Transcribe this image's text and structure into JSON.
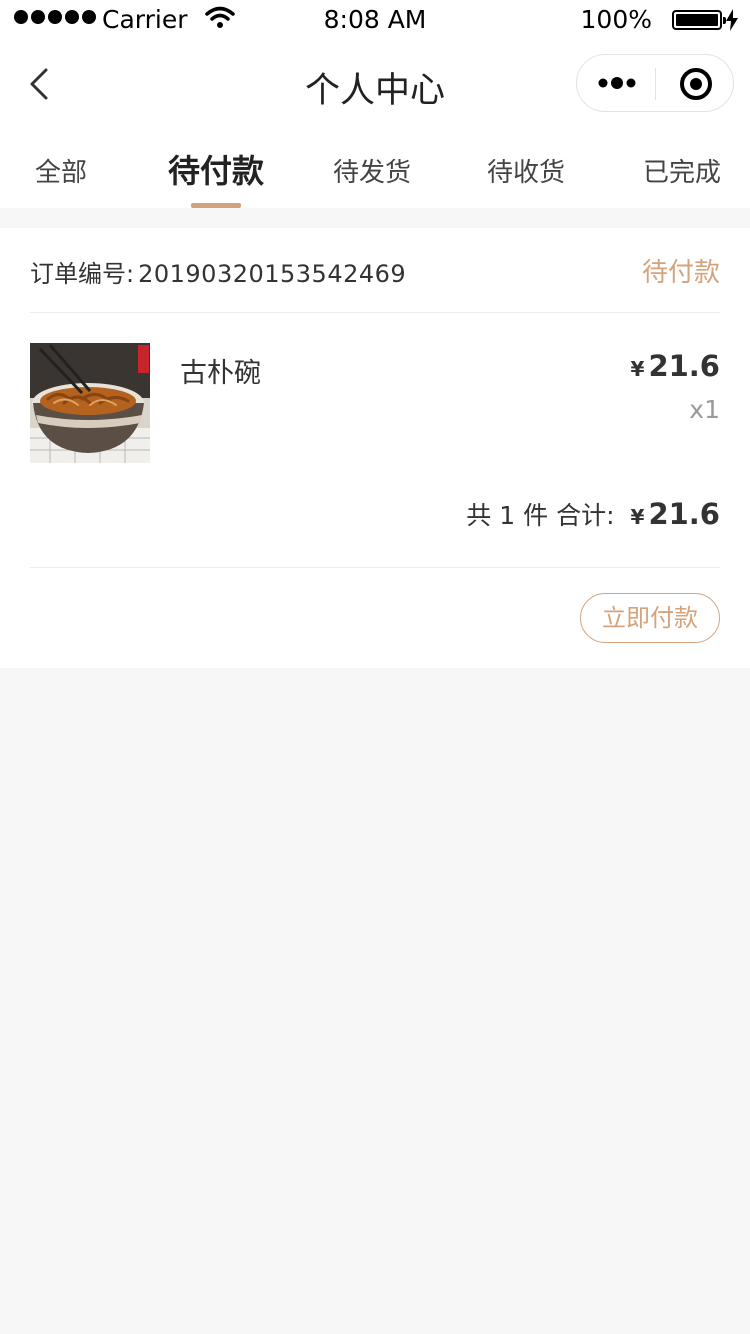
{
  "status_bar": {
    "carrier": "Carrier",
    "time": "8:08 AM",
    "battery": "100%"
  },
  "nav": {
    "title": "个人中心",
    "back_icon": "chevron-left-icon",
    "more_icon": "more-dots-icon",
    "close_icon": "target-close-icon"
  },
  "tabs": [
    {
      "label": "全部",
      "active": false
    },
    {
      "label": "待付款",
      "active": true
    },
    {
      "label": "待发货",
      "active": false
    },
    {
      "label": "待收货",
      "active": false
    },
    {
      "label": "已完成",
      "active": false
    }
  ],
  "order": {
    "number_label": "订单编号:",
    "number": "20190320153542469",
    "status": "待付款",
    "item": {
      "name": "古朴碗",
      "currency": "¥",
      "price": "21.6",
      "qty": "x1"
    },
    "summary": {
      "count_text": "共 1 件",
      "total_label": "合计:",
      "currency": "¥",
      "total": "21.6"
    },
    "pay_button": "立即付款"
  },
  "colors": {
    "accent": "#d4a37c",
    "background": "#f7f7f7",
    "card": "#ffffff"
  }
}
